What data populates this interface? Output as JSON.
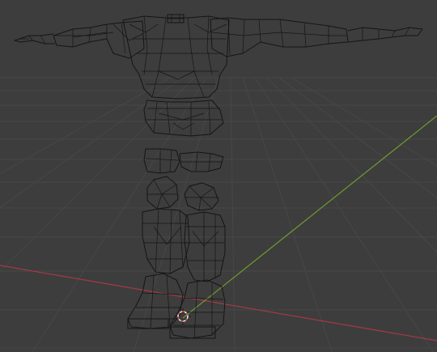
{
  "viewport": {
    "background_color": "#3d3d3d",
    "grid_color": "#474747",
    "x_axis_color": "#a33a46",
    "y_axis_color": "#6f9a2f",
    "wireframe_color": "#151515",
    "shading_mode": "wireframe"
  },
  "scene": {
    "object": "character-mesh-t-pose",
    "cursor_icon": "3d-cursor-icon",
    "cursor_colors": [
      "#ffffff",
      "#d9534f"
    ]
  }
}
